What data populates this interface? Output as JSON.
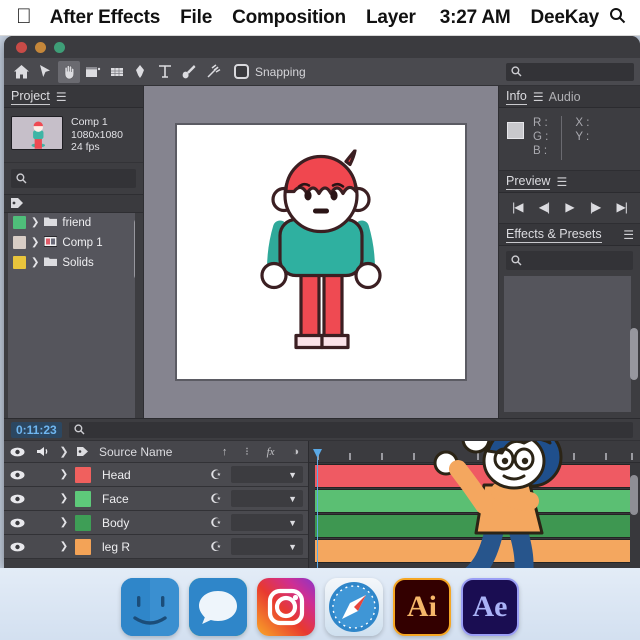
{
  "menubar": {
    "apple_icon": "apple-logo",
    "items": [
      "After Effects",
      "File",
      "Composition",
      "Layer"
    ],
    "time": "3:27 AM",
    "user": "DeeKay",
    "search_icon": "search-icon"
  },
  "window": {
    "traffic_lights": [
      "close",
      "minimize",
      "zoom"
    ]
  },
  "toolbar": {
    "tools": [
      {
        "name": "home-icon",
        "glyph": "⌂"
      },
      {
        "name": "selection-arrow-icon",
        "glyph": "➤"
      },
      {
        "name": "hand-tool-icon",
        "glyph": "✋"
      },
      {
        "name": "zoom-tool-icon",
        "glyph": "▤"
      },
      {
        "name": "orbit-tool-icon",
        "glyph": "▦"
      },
      {
        "name": "pen-tool-icon",
        "glyph": "✒"
      },
      {
        "name": "text-tool-icon",
        "glyph": "T"
      },
      {
        "name": "brush-tool-icon",
        "glyph": "✐"
      },
      {
        "name": "clone-stamp-icon",
        "glyph": "✂"
      }
    ],
    "snapping_label": "Snapping",
    "snapping_checked": false,
    "search_placeholder": ""
  },
  "project": {
    "tab_label": "Project",
    "menu_icon": "hamburger-icon",
    "comp": {
      "name": "Comp 1",
      "resolution": "1080x1080",
      "framerate": "24 fps"
    },
    "search_placeholder": "",
    "items": [
      {
        "label": "friend",
        "color": "#4fbe7a",
        "icon": "folder-icon"
      },
      {
        "label": "Comp 1",
        "color": "#d8cdc6",
        "icon": "composition-icon"
      },
      {
        "label": "Solids",
        "color": "#e8c43c",
        "icon": "folder-icon"
      }
    ]
  },
  "right_panels": {
    "info": {
      "tab_label": "Info",
      "audio_tab_label": "Audio",
      "menu_icon": "hamburger-icon",
      "channels": [
        "R :",
        "G :",
        "B :"
      ],
      "coords": [
        "X :",
        "Y :"
      ]
    },
    "preview": {
      "tab_label": "Preview",
      "menu_icon": "hamburger-icon",
      "buttons": [
        {
          "name": "first-frame-button",
          "glyph": "|◀"
        },
        {
          "name": "previous-frame-button",
          "glyph": "◀|"
        },
        {
          "name": "play-button",
          "glyph": "▶"
        },
        {
          "name": "next-frame-button",
          "glyph": "|▶"
        },
        {
          "name": "last-frame-button",
          "glyph": "▶|"
        }
      ]
    },
    "effects": {
      "tab_label": "Effects & Presets",
      "menu_icon": "hamburger-icon",
      "search_placeholder": ""
    }
  },
  "timeline": {
    "timecode": "0:11:23",
    "search_placeholder": "",
    "columns": {
      "source_name": "Source Name",
      "switches": [
        "parent-icon",
        "shy-icon",
        "fx-icon",
        "motion-blur-icon"
      ]
    },
    "layers": [
      {
        "name": "Head",
        "color": "#f0605e",
        "bar_color": "#ef5a63",
        "visible": true,
        "dropdown_value": ""
      },
      {
        "name": "Face",
        "color": "#5ec97a",
        "bar_color": "#5bbf73",
        "visible": true,
        "dropdown_value": ""
      },
      {
        "name": "Body",
        "color": "#3e9e56",
        "bar_color": "#3e9751",
        "visible": true,
        "dropdown_value": ""
      },
      {
        "name": "leg R",
        "color": "#f3a357",
        "bar_color": "#f4a75f",
        "visible": true,
        "dropdown_value": ""
      }
    ]
  },
  "dock": {
    "items": [
      {
        "name": "finder",
        "label": "Finder"
      },
      {
        "name": "messages",
        "label": "Messages"
      },
      {
        "name": "instagram",
        "label": "Instagram"
      },
      {
        "name": "safari",
        "label": "Safari"
      },
      {
        "name": "illustrator",
        "label": "Ai"
      },
      {
        "name": "after-effects",
        "label": "Ae"
      }
    ]
  },
  "colors": {
    "panel_bg": "#3d3d41",
    "toolbar_bg": "#4a4a4f",
    "viewer_bg": "#85848f",
    "canvas_bg": "#ffffff",
    "accent_blue": "#5aa9e6",
    "timecode_blue": "#6fb6f0"
  }
}
